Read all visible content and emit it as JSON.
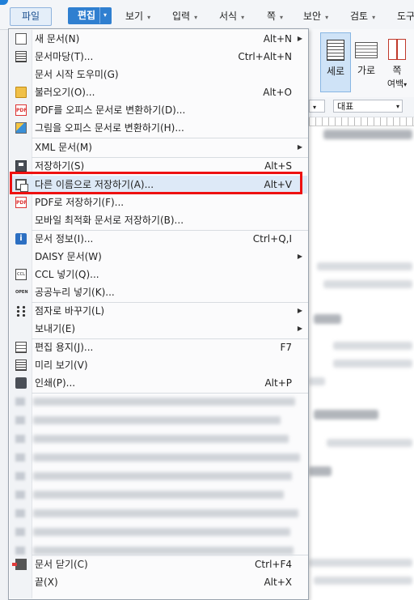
{
  "menubar": {
    "items": [
      "파일",
      "편집",
      "보기",
      "입력",
      "서식",
      "쪽",
      "보안",
      "검토",
      "도구"
    ]
  },
  "ribbon": {
    "portrait": "세로",
    "landscape": "가로",
    "columns_top": "쪽",
    "columns_bottom": "여백"
  },
  "format_bar": {
    "style": "대표"
  },
  "file_menu": {
    "items": [
      {
        "label": "새 문서(N)",
        "shortcut": "Alt+N",
        "submenu": true,
        "icon": "new-document-icon"
      },
      {
        "label": "문서마당(T)...",
        "shortcut": "Ctrl+Alt+N",
        "icon": "template-icon"
      },
      {
        "label": "문서 시작 도우미(G)",
        "shortcut": "",
        "icon": ""
      },
      {
        "label": "불러오기(O)...",
        "shortcut": "Alt+O",
        "icon": "folder-open-icon"
      },
      {
        "label": "PDF를 오피스 문서로 변환하기(D)...",
        "shortcut": "",
        "icon": "pdf-icon"
      },
      {
        "label": "그림을 오피스 문서로 변환하기(H)...",
        "shortcut": "",
        "icon": "image-convert-icon"
      },
      {
        "label": "XML 문서(M)",
        "shortcut": "",
        "submenu": true,
        "icon": ""
      },
      {
        "label": "저장하기(S)",
        "shortcut": "Alt+S",
        "icon": "save-icon"
      },
      {
        "label": "다른 이름으로 저장하기(A)...",
        "shortcut": "Alt+V",
        "icon": "save-as-icon"
      },
      {
        "label": "PDF로 저장하기(F)...",
        "shortcut": "",
        "icon": "pdf-save-icon"
      },
      {
        "label": "모바일 최적화 문서로 저장하기(B)...",
        "shortcut": "",
        "icon": ""
      },
      {
        "label": "문서 정보(I)...",
        "shortcut": "Ctrl+Q,I",
        "icon": "info-icon"
      },
      {
        "label": "DAISY 문서(W)",
        "shortcut": "",
        "submenu": true,
        "icon": ""
      },
      {
        "label": "CCL 넣기(Q)...",
        "shortcut": "",
        "icon": "ccl-icon"
      },
      {
        "label": "공공누리 넣기(K)...",
        "shortcut": "",
        "icon": "open-license-icon"
      },
      {
        "label": "점자로 바꾸기(L)",
        "shortcut": "",
        "submenu": true,
        "icon": "braille-icon"
      },
      {
        "label": "보내기(E)",
        "shortcut": "",
        "submenu": true,
        "icon": ""
      },
      {
        "label": "편집 용지(J)...",
        "shortcut": "F7",
        "icon": "page-setup-icon"
      },
      {
        "label": "미리 보기(V)",
        "shortcut": "",
        "icon": "preview-icon"
      },
      {
        "label": "인쇄(P)...",
        "shortcut": "Alt+P",
        "icon": "print-icon"
      },
      {
        "label": "문서 닫기(C)",
        "shortcut": "Ctrl+F4",
        "icon": "close-document-icon"
      },
      {
        "label": "끝(X)",
        "shortcut": "Alt+X",
        "icon": ""
      }
    ],
    "highlighted": "다른 이름으로 저장하기(A)...",
    "highlight_color": "#ee1111"
  }
}
